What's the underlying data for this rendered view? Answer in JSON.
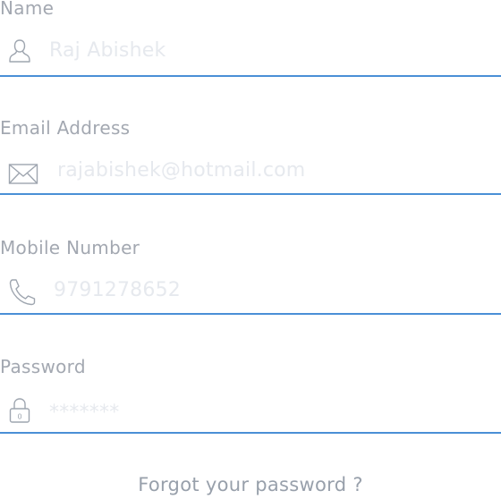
{
  "form": {
    "name": {
      "label": "Name",
      "value": "Raj Abishek",
      "icon": "user-icon"
    },
    "email": {
      "label": "Email Address",
      "value": "rajabishek@hotmail.com",
      "icon": "envelope-icon"
    },
    "mobile": {
      "label": "Mobile Number",
      "value": "9791278652",
      "icon": "phone-icon"
    },
    "password": {
      "label": "Password",
      "value": "*******",
      "icon": "lock-icon"
    },
    "forgot_link": "Forgot your password ?"
  },
  "colors": {
    "underline": "#4a8fd6",
    "label": "#a3a8b1",
    "value": "#e6e9ee",
    "icon": "#9ea5af"
  }
}
